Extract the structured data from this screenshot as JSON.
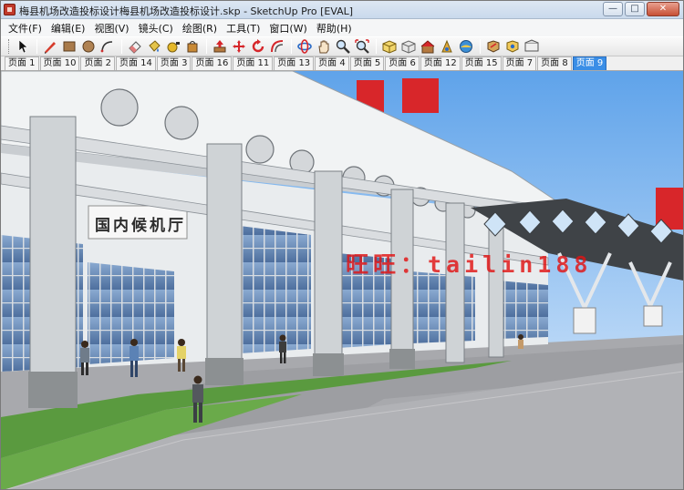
{
  "window": {
    "title": "梅县机场改造投标设计梅县机场改造投标设计.skp - SketchUp Pro [EVAL]",
    "app_icon": "sketchup-icon",
    "buttons": [
      {
        "name": "minimize-button",
        "glyph": "—"
      },
      {
        "name": "maximize-button",
        "glyph": "□"
      },
      {
        "name": "close-button",
        "glyph": "✕"
      }
    ]
  },
  "menu": {
    "items": [
      "文件(F)",
      "编辑(E)",
      "视图(V)",
      "镜头(C)",
      "绘图(R)",
      "工具(T)",
      "窗口(W)",
      "帮助(H)"
    ]
  },
  "toolbar": {
    "tools": [
      "select-icon",
      "pencil-line-icon",
      "rectangle-icon",
      "circle-icon",
      "arc-icon",
      "eraser-icon",
      "paint-bucket-icon",
      "tape-measure-icon",
      "paint-icon",
      "push-pull-icon",
      "move-icon",
      "rotate-icon",
      "offset-icon",
      "orbit-icon",
      "pan-icon",
      "zoom-icon",
      "zoom-extents-icon",
      "components-icon",
      "materials-icon",
      "warehouse-icon",
      "get-models-icon",
      "share-icon",
      "section-plane-icon",
      "extension-icon",
      "layout-icon"
    ]
  },
  "scenes": {
    "tabs": [
      "页面 1",
      "页面 10",
      "页面 2",
      "页面 14",
      "页面 3",
      "页面 16",
      "页面 11",
      "页面 13",
      "页面 4",
      "页面 5",
      "页面 6",
      "页面 12",
      "页面 15",
      "页面 7",
      "页面 8",
      "页面 9"
    ],
    "active_index": 15
  },
  "viewport": {
    "sign": "国内候机厅",
    "watermark": "旺旺：tailin188",
    "colors": {
      "sky": "#7fb6ef",
      "roof_red": "#d8262a",
      "ground": "#a9a9ab",
      "grass": "#5a9a3f",
      "concrete": "#d8dcdf",
      "glass": "#6c8fbe"
    }
  }
}
